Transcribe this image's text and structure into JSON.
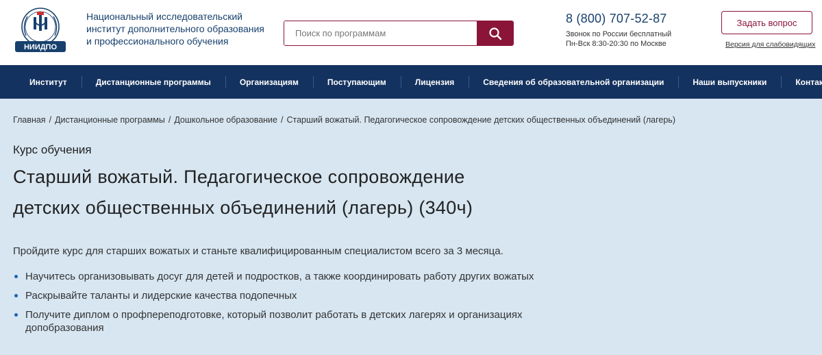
{
  "header": {
    "logo_text": "НИИДПО",
    "org_name_lines": [
      "Национальный исследовательский",
      "институт дополнительного образования",
      "и профессионального обучения"
    ],
    "search": {
      "placeholder": "Поиск по программам",
      "value": ""
    },
    "phone": "8 (800) 707-52-87",
    "phone_note_lines": [
      "Звонок по России бесплатный",
      "Пн-Вск 8:30-20:30 по Москве"
    ],
    "ask_button": "Задать вопрос",
    "impaired_link": "Версия для слабовидящих"
  },
  "nav": {
    "items": [
      "Институт",
      "Дистанционные программы",
      "Организациям",
      "Поступающим",
      "Лицензия",
      "Сведения об образовательной организации",
      "Наши выпускники",
      "Контакты"
    ]
  },
  "breadcrumb": {
    "items": [
      "Главная",
      "Дистанционные программы",
      "Дошкольное образование",
      "Старший вожатый. Педагогическое сопровождение детских общественных объединений (лагерь)"
    ],
    "separator": "/"
  },
  "main": {
    "course_label": "Курс обучения",
    "title_lines": [
      "Старший вожатый. Педагогическое сопровождение",
      "детских общественных объединений (лагерь) (340ч)"
    ],
    "intro": "Пройдите курс для старших вожатых и станьте квалифицированным специалистом всего за 3 месяца.",
    "bullets": [
      "Научитесь организовывать досуг для детей и подростков, а также координировать работу других вожатых",
      "Раскрывайте таланты и лидерские качества подопечных",
      "Получите диплом о профпереподготовке, который позволит работать в детских лагерях и организациях допобразования"
    ]
  },
  "colors": {
    "brand_blue": "#14325f",
    "accent_red": "#8a1538",
    "content_bg": "#d7e6f1",
    "bullet_blue": "#1f62b3"
  },
  "icons": {
    "search": "search-icon",
    "logo": "institute-logo-icon"
  }
}
